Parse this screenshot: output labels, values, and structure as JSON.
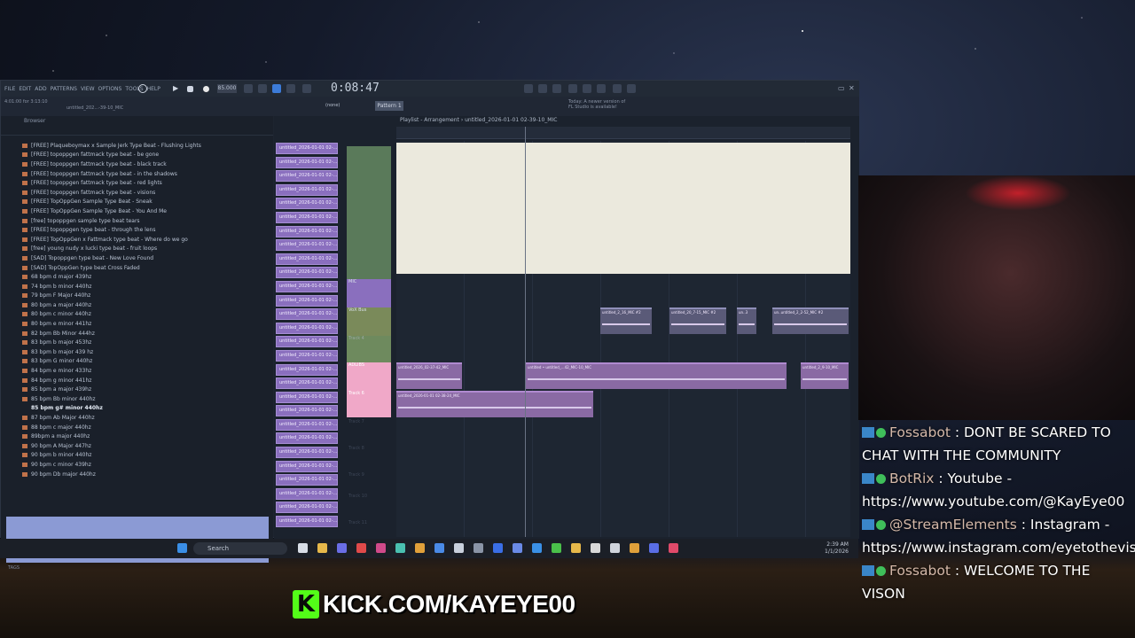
{
  "app": {
    "menu": [
      "FILE",
      "EDIT",
      "ADD",
      "PATTERNS",
      "VIEW",
      "OPTIONS",
      "TOOLS",
      "HELP"
    ],
    "time": "0:08:47",
    "tempo": "85.000",
    "pattern": "Pattern 1",
    "snap": "(none)",
    "hint": "Today: A newer version of FL Studio is available!",
    "window_status": "4:01:00 for 3:13:10",
    "project_short": "untitled_202...-39-10_MIC"
  },
  "browser": {
    "title": "Browser",
    "items": [
      "[FREE] Plaqueboymax x Sample Jerk Type Beat - Flushing Lights",
      "[FREE] topoppgen  fattmack type beat - be gone",
      "[FREE] topoppgen  fattmack type beat - black track",
      "[FREE] topoppgen  fattmack type beat - in the shadows",
      "[FREE] topoppgen  fattmack type beat - red lights",
      "[FREE] topoppgen  fattmack type beat - visions",
      "[FREE] TopOppGen Sample Type Beat - Sneak",
      "[FREE] TopOppGen Sample Type Beat - You And Me",
      "[free] topoppgen sample type beat tears",
      "[FREE] topoppgen type beat - through the lens",
      "[FREE] TopOppGen x Fattmack type beat - Where do we go",
      "[free] young nudy x lucki type beat - fruit loops",
      "[SAD] Topoppgen type beat - New Love Found",
      "[SAD] TopOppGen type beat Cross Faded",
      "68 bpm d major 439hz",
      "74 bpm b minor 440hz",
      "79 bpm F Major 440hz",
      "80 bpm a major 440hz",
      "80 bpm c minor 440hz",
      "80 bpm e minor 441hz",
      "82 bpm Bb Minor 444hz",
      "83 bpm b major 453hz",
      "83 bpm b major 439 hz",
      "83 bpm G minor 440hz",
      "84 bpm e minor 433hz",
      "84 bpm g minor 441hz",
      "85 bpm a major 439hz",
      "85 bpm Bb minor 440hz",
      "85 bpm g# minor 440hz",
      "87 bpm Ab Major 440hz",
      "88 bpm c major 440hz",
      "89bpm a major 440hz",
      "90 bpm A Major 447hz",
      "90 bpm b minor 440hz",
      "90 bpm c minor 439hz",
      "90 bpm Db major 440hz"
    ],
    "selected_index": 28,
    "tags_label": "TAGS"
  },
  "playlist": {
    "title": "Playlist - Arrangement › untitled_2026-01-01 02-39-10_MIC",
    "clip_label": "untitled_2026-01-01 02-...",
    "clip_count": 28,
    "tracks": [
      {
        "name": "MIC",
        "color": "#8a6fbe"
      },
      {
        "name": "VoX Bus",
        "color": "#7a8a5a"
      },
      {
        "name": "Track 4",
        "color": ""
      },
      {
        "name": "ADLIBS",
        "color": "#f0a8c8"
      },
      {
        "name": "Track 6",
        "color": "#f0a8c8"
      },
      {
        "name": "Track 7",
        "color": ""
      },
      {
        "name": "Track 8",
        "color": ""
      },
      {
        "name": "Track 9",
        "color": ""
      },
      {
        "name": "Track 10",
        "color": ""
      },
      {
        "name": "Track 11",
        "color": ""
      }
    ],
    "clips": [
      {
        "label": "untitled_2_16_MIC #2",
        "row": "vox"
      },
      {
        "label": "untitled_20_7-15_MIC #2",
        "row": "vox"
      },
      {
        "label": "un..3",
        "row": "vox"
      },
      {
        "label": "un..untitled_2_2-52_MIC #2",
        "row": "vox"
      },
      {
        "label": "untitled_2026_02-37-42_MIC",
        "row": "adlib"
      },
      {
        "label": "untitled • untitled_...42_MIC-10_MIC",
        "row": "adlib"
      },
      {
        "label": "untitled_2_9-10_MIC",
        "row": "adlib"
      },
      {
        "label": "untitled_2026-01-01 02-38-24_MIC",
        "row": "track6"
      }
    ]
  },
  "taskbar": {
    "search": "Search",
    "time": "2:39 AM",
    "date": "1/1/2026"
  },
  "chat": [
    {
      "user": "Fossabot",
      "text": " : DONT BE SCARED TO CHAT WITH THE COMMUNITY"
    },
    {
      "user": "BotRix",
      "text": " : Youtube - https://www.youtube.com/@KayEye00"
    },
    {
      "user": "@StreamElements",
      "text": " : Instagram - https://www.instagram.com/eyetothevision/"
    },
    {
      "user": "Fossabot",
      "text": " : WELCOME TO THE VISON"
    }
  ],
  "overlay": {
    "kick_logo": "K",
    "kick_url": "KICK.COM/KAYEYE00"
  },
  "colors": {
    "clip_purple": "#8a6fbe",
    "kick_green": "#53fc18",
    "chat_user": "#d4b8a8"
  }
}
